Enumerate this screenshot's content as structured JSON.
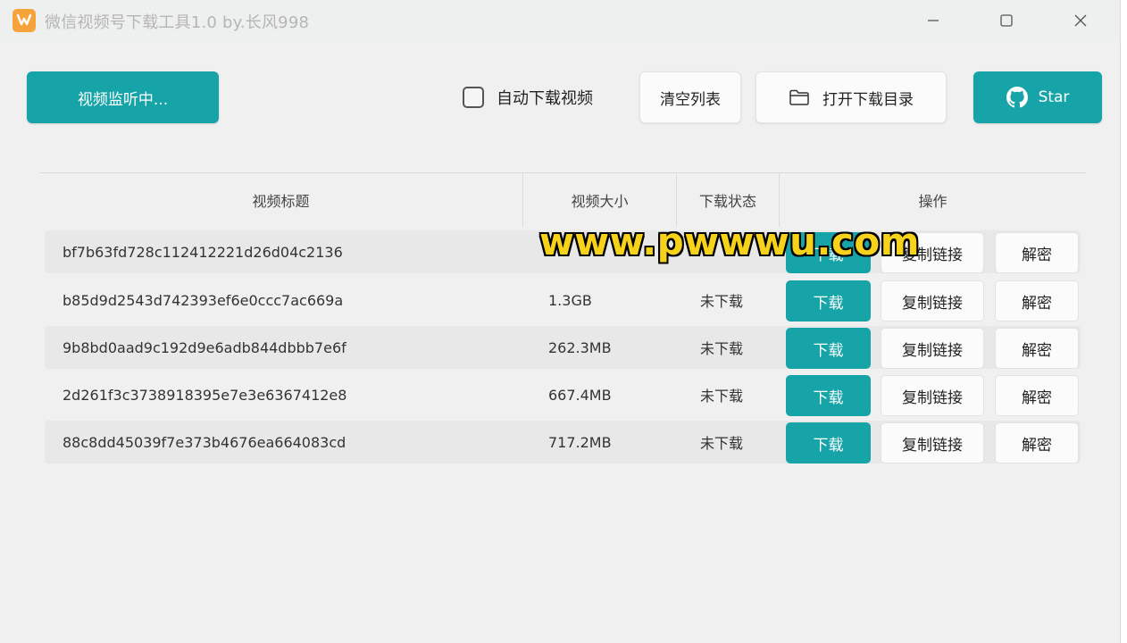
{
  "window": {
    "title": "微信视频号下载工具1.0 by.长风998"
  },
  "toolbar": {
    "monitor_button": "视频监听中...",
    "auto_download_label": "自动下载视频",
    "auto_download_checked": false,
    "clear_list_button": "清空列表",
    "open_dir_button": "打开下载目录",
    "star_button": "Star"
  },
  "table": {
    "headers": [
      "视频标题",
      "视频大小",
      "下载状态",
      "操作"
    ],
    "rows": [
      {
        "title": "bf7b63fd728c112412221d26d04c2136",
        "size": "",
        "status": "",
        "download": "下载",
        "copy": "复制链接",
        "decrypt": "解密"
      },
      {
        "title": "b85d9d2543d742393ef6e0ccc7ac669a",
        "size": "1.3GB",
        "status": "未下载",
        "download": "下载",
        "copy": "复制链接",
        "decrypt": "解密"
      },
      {
        "title": "9b8bd0aad9c192d9e6adb844dbbb7e6f",
        "size": "262.3MB",
        "status": "未下载",
        "download": "下载",
        "copy": "复制链接",
        "decrypt": "解密"
      },
      {
        "title": "2d261f3c3738918395e7e3e6367412e8",
        "size": "667.4MB",
        "status": "未下载",
        "download": "下载",
        "copy": "复制链接",
        "decrypt": "解密"
      },
      {
        "title": "88c8dd45039f7e373b4676ea664083cd",
        "size": "717.2MB",
        "status": "未下载",
        "download": "下载",
        "copy": "复制链接",
        "decrypt": "解密"
      }
    ]
  },
  "watermark": "www.pwwwu.com",
  "colors": {
    "accent": "#16a4a8",
    "app_icon": "#f7a33c",
    "watermark": "#f7d21a"
  },
  "icons": {
    "app": "app-logo-icon",
    "minimize": "minimize-icon",
    "maximize": "maximize-icon",
    "close": "close-icon",
    "folder": "folder-icon",
    "github": "github-icon"
  }
}
